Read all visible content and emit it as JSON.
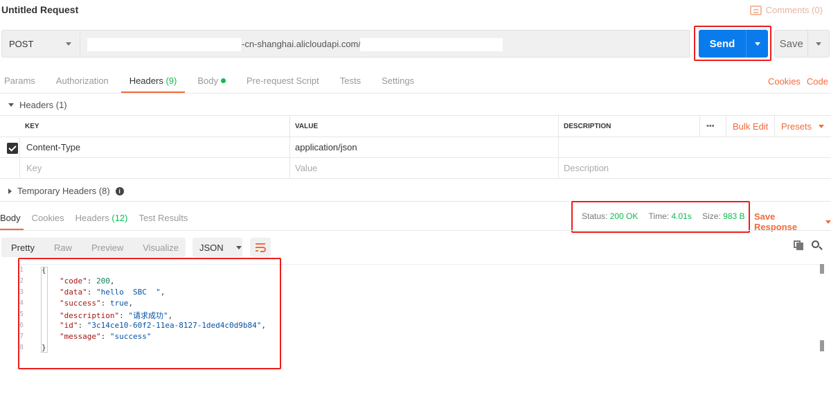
{
  "title": "Untitled Request",
  "comments_label": "Comments (0)",
  "request": {
    "method": "POST",
    "url_visible": "-cn-shanghai.alicloudapi.com/a",
    "send_label": "Send",
    "save_label": "Save"
  },
  "req_tabs": [
    {
      "label": "Params"
    },
    {
      "label": "Authorization"
    },
    {
      "label": "Headers",
      "count": "(9)"
    },
    {
      "label": "Body"
    },
    {
      "label": "Pre-request Script"
    },
    {
      "label": "Tests"
    },
    {
      "label": "Settings"
    }
  ],
  "req_links": {
    "cookies": "Cookies",
    "code": "Code"
  },
  "headers_section": {
    "title": "Headers (1)",
    "columns": {
      "key": "KEY",
      "value": "VALUE",
      "description": "DESCRIPTION"
    },
    "more": "•••",
    "bulk_edit": "Bulk Edit",
    "presets": "Presets",
    "rows": [
      {
        "key": "Content-Type",
        "value": "application/json",
        "description": ""
      }
    ],
    "placeholder": {
      "key": "Key",
      "value": "Value",
      "description": "Description"
    },
    "temporary": "Temporary Headers (8)"
  },
  "response": {
    "tabs": [
      {
        "label": "Body"
      },
      {
        "label": "Cookies"
      },
      {
        "label": "Headers",
        "count": "(12)"
      },
      {
        "label": "Test Results"
      }
    ],
    "status_label": "Status:",
    "status_value": "200 OK",
    "time_label": "Time:",
    "time_value": "4.01s",
    "size_label": "Size:",
    "size_value": "983 B",
    "save_response": "Save Response",
    "view_modes": [
      "Pretty",
      "Raw",
      "Preview",
      "Visualize"
    ],
    "format": "JSON",
    "line_numbers": [
      "1",
      "2",
      "3",
      "4",
      "5",
      "6",
      "7",
      "8"
    ],
    "body": {
      "open": "{",
      "close": "}",
      "fields": [
        {
          "key": "\"code\"",
          "value": "200",
          "type": "n"
        },
        {
          "key": "\"data\"",
          "value": "\"hello  SBC  \"",
          "type": "s"
        },
        {
          "key": "\"success\"",
          "value": "true",
          "type": "b"
        },
        {
          "key": "\"description\"",
          "value": "\"请求成功\"",
          "type": "s"
        },
        {
          "key": "\"id\"",
          "value": "\"3c14ce10-60f2-11ea-8127-1ded4c0d9b84\"",
          "type": "s"
        },
        {
          "key": "\"message\"",
          "value": "\"success\"",
          "type": "s"
        }
      ]
    }
  },
  "colors": {
    "accent": "#f26b3a",
    "send": "#097bed",
    "status_ok": "#0cbb52",
    "highlight": "#ee1c1c"
  }
}
